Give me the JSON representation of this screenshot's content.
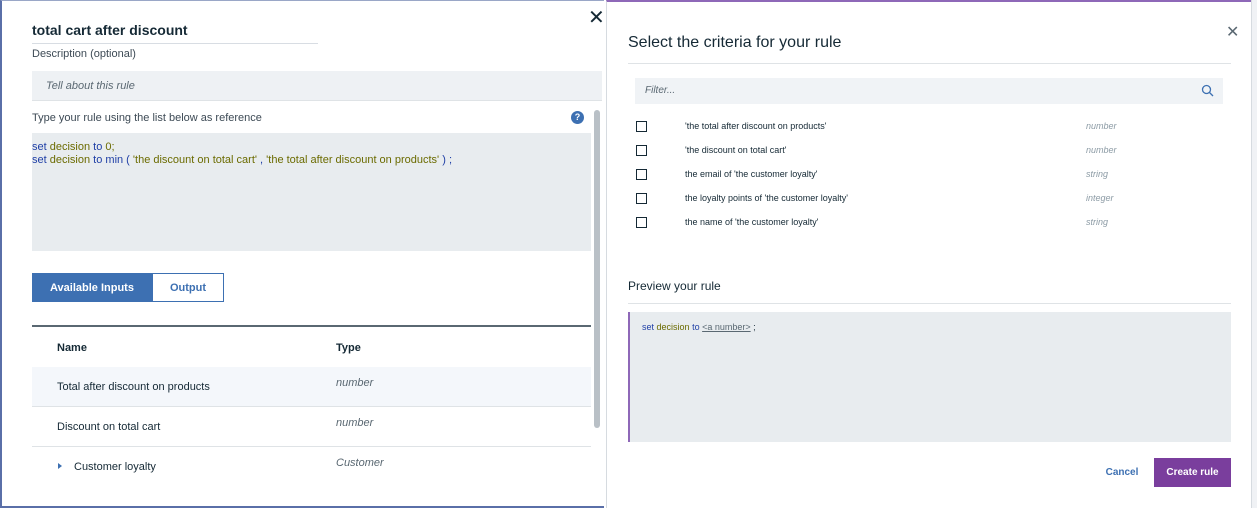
{
  "rule_editor": {
    "title": "total cart after discount",
    "description_label": "Description (optional)",
    "description_placeholder": "Tell about this rule",
    "instructions": "Type your rule using the list below as reference",
    "help_glyph": "?",
    "code_line1": {
      "kw1": "set",
      "var1": "decision",
      "kw2": "to",
      "num": "0;"
    },
    "code_line2": {
      "kw1": "set",
      "var1": "decision",
      "kw2": "to min (",
      "str1": "'the discount on total cart'",
      "sep": ",",
      "str2": "'the total after discount on products'",
      "end": ") ;"
    },
    "tabs": [
      {
        "label": "Available Inputs",
        "active": true
      },
      {
        "label": "Output",
        "active": false
      }
    ],
    "table": {
      "headers": [
        "Name",
        "Type"
      ],
      "rows": [
        {
          "name": "Total after discount on products",
          "type": "number"
        },
        {
          "name": "Discount on total cart",
          "type": "number"
        },
        {
          "name": "Customer loyalty",
          "type": "Customer",
          "expandable": true
        }
      ]
    },
    "close_glyph": "✕"
  },
  "criteria_modal": {
    "title": "Select the criteria for your rule",
    "close_glyph": "✕",
    "filter_placeholder": "Filter...",
    "criteria": [
      {
        "label": "'the total after discount on products'",
        "type": "number",
        "checked": false
      },
      {
        "label": "'the discount on total cart'",
        "type": "number",
        "checked": false
      },
      {
        "label": "the email of 'the customer loyalty'",
        "type": "string",
        "checked": false
      },
      {
        "label": "the loyalty points of 'the customer loyalty'",
        "type": "integer",
        "checked": false
      },
      {
        "label": "the name of 'the customer loyalty'",
        "type": "string",
        "checked": false
      }
    ],
    "preview_label": "Preview your rule",
    "preview": {
      "kw1": "set",
      "var1": "decision",
      "kw2": "to",
      "placeholder": "<a number>",
      "end": ";"
    },
    "cancel_label": "Cancel",
    "create_label": "Create rule"
  },
  "colors": {
    "accent_blue": "#3d70b2",
    "accent_purple": "#7a3e9d"
  }
}
